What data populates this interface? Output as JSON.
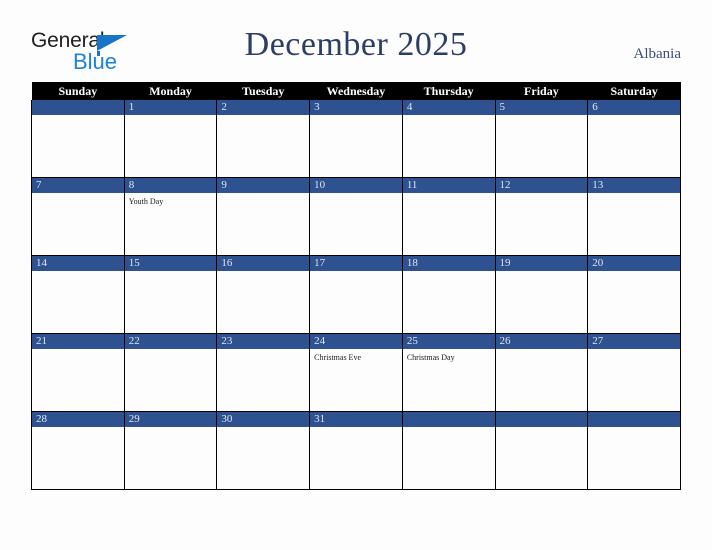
{
  "brand": {
    "name_part1": "General",
    "name_part2": "Blue",
    "triangle_icon": "triangle-icon",
    "accent_dark": "#231f20",
    "accent_blue": "#1b84d8"
  },
  "header": {
    "title": "December 2025",
    "country": "Albania",
    "title_color": "#2c3e66",
    "country_color": "#3a4f78"
  },
  "calendar": {
    "header_bg": "#000000",
    "date_bar_bg": "#2e5190",
    "weekdays": [
      "Sunday",
      "Monday",
      "Tuesday",
      "Wednesday",
      "Thursday",
      "Friday",
      "Saturday"
    ],
    "weeks": [
      [
        {
          "date": "",
          "events": []
        },
        {
          "date": "1",
          "events": []
        },
        {
          "date": "2",
          "events": []
        },
        {
          "date": "3",
          "events": []
        },
        {
          "date": "4",
          "events": []
        },
        {
          "date": "5",
          "events": []
        },
        {
          "date": "6",
          "events": []
        }
      ],
      [
        {
          "date": "7",
          "events": []
        },
        {
          "date": "8",
          "events": [
            "Youth Day"
          ]
        },
        {
          "date": "9",
          "events": []
        },
        {
          "date": "10",
          "events": []
        },
        {
          "date": "11",
          "events": []
        },
        {
          "date": "12",
          "events": []
        },
        {
          "date": "13",
          "events": []
        }
      ],
      [
        {
          "date": "14",
          "events": []
        },
        {
          "date": "15",
          "events": []
        },
        {
          "date": "16",
          "events": []
        },
        {
          "date": "17",
          "events": []
        },
        {
          "date": "18",
          "events": []
        },
        {
          "date": "19",
          "events": []
        },
        {
          "date": "20",
          "events": []
        }
      ],
      [
        {
          "date": "21",
          "events": []
        },
        {
          "date": "22",
          "events": []
        },
        {
          "date": "23",
          "events": []
        },
        {
          "date": "24",
          "events": [
            "Christmas Eve"
          ]
        },
        {
          "date": "25",
          "events": [
            "Christmas Day"
          ]
        },
        {
          "date": "26",
          "events": []
        },
        {
          "date": "27",
          "events": []
        }
      ],
      [
        {
          "date": "28",
          "events": []
        },
        {
          "date": "29",
          "events": []
        },
        {
          "date": "30",
          "events": []
        },
        {
          "date": "31",
          "events": []
        },
        {
          "date": "",
          "events": []
        },
        {
          "date": "",
          "events": []
        },
        {
          "date": "",
          "events": []
        }
      ]
    ]
  }
}
